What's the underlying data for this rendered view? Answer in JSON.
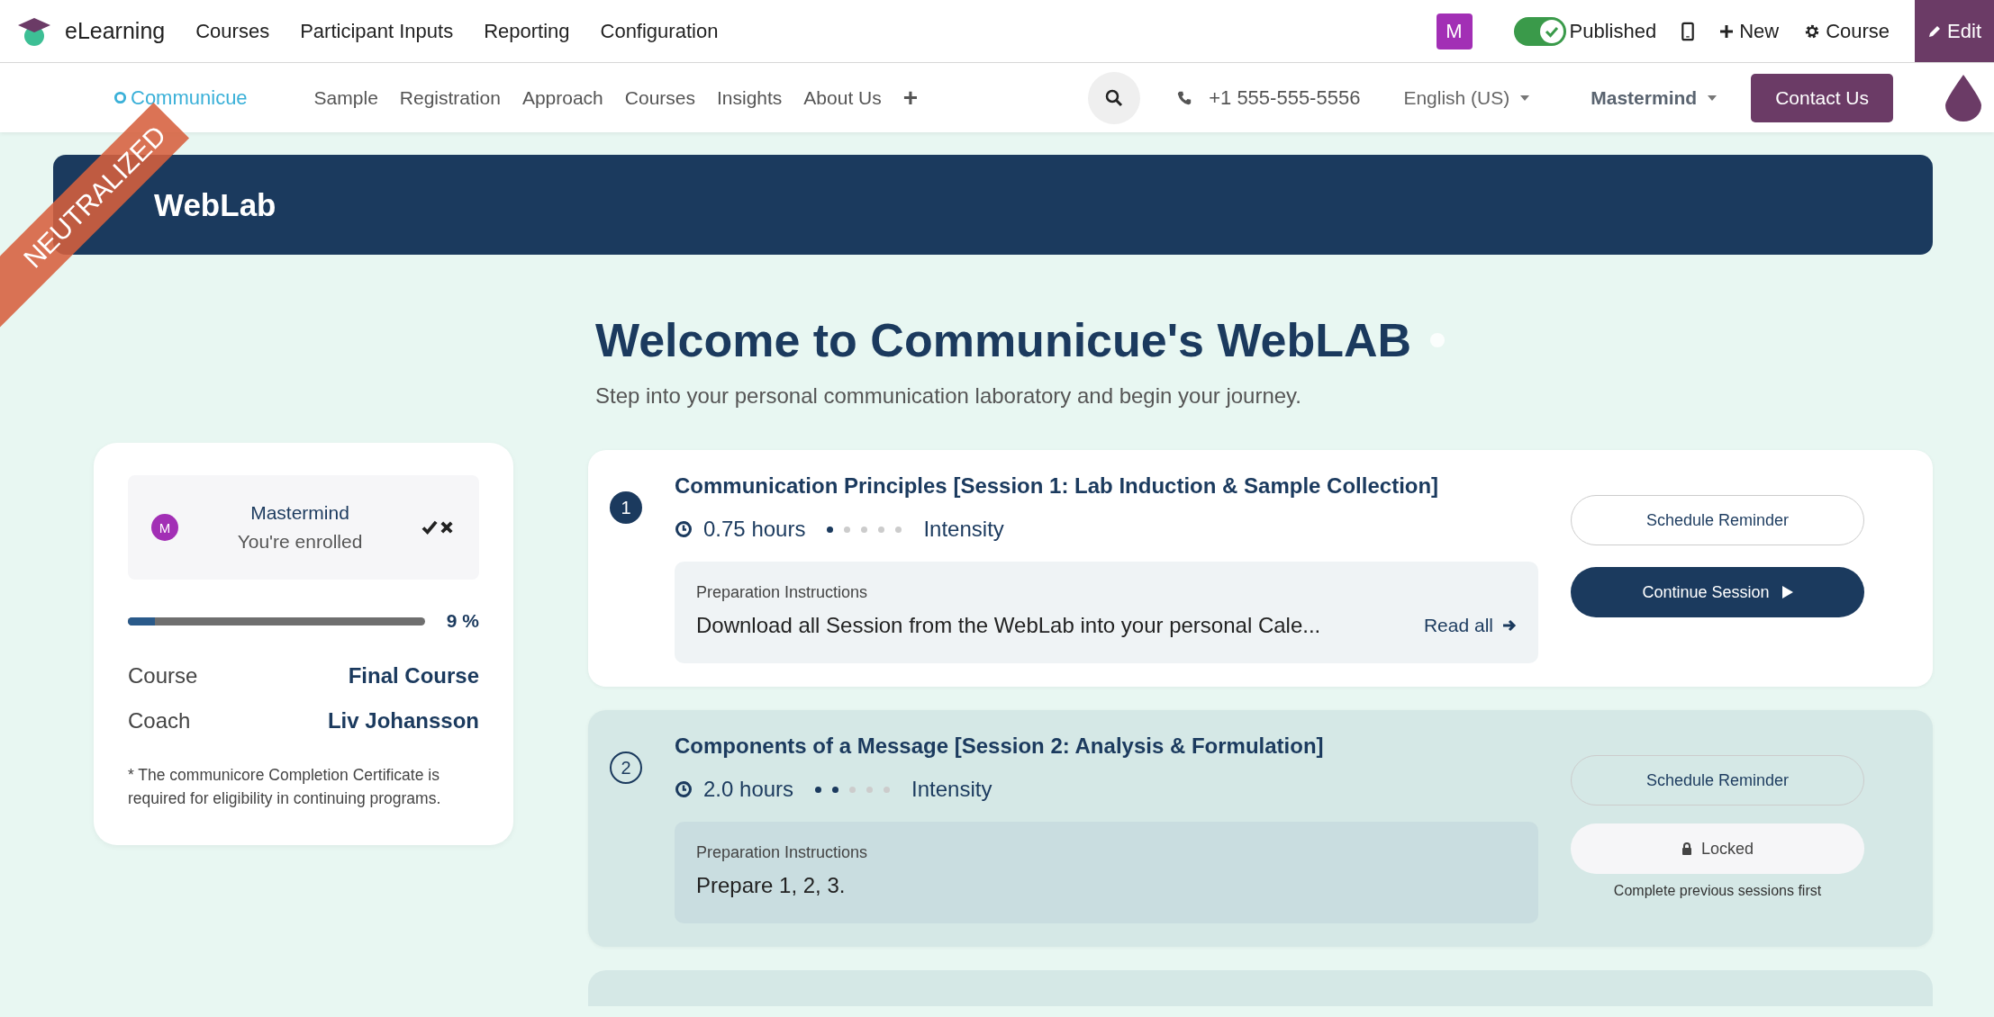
{
  "topbar": {
    "app_name": "eLearning",
    "menu": [
      "Courses",
      "Participant Inputs",
      "Reporting",
      "Configuration"
    ],
    "user_initial": "M",
    "published": {
      "label": "Published",
      "on": true
    },
    "new_label": "New",
    "course_label": "Course",
    "edit_label": "Edit"
  },
  "ribbon": "NEUTRALIZED",
  "sitenav": {
    "logo": "Communicue",
    "links": [
      "Sample",
      "Registration",
      "Approach",
      "Courses",
      "Insights",
      "About Us"
    ],
    "add": "+",
    "phone": "+1 555-555-5556",
    "language": "English (US)",
    "user": "Mastermind",
    "contact": "Contact Us"
  },
  "banner": {
    "title": "WebLab"
  },
  "welcome": {
    "title": "Welcome to Communicue's WebLAB",
    "subtitle": "Step into your personal communication laboratory and begin your journey."
  },
  "enrollment": {
    "avatar": "M",
    "name": "Mastermind",
    "status": "You're enrolled",
    "progress": {
      "level": 0.09,
      "label": "9 %"
    },
    "fields": [
      {
        "label": "Course",
        "value": "Final Course"
      },
      {
        "label": "Coach",
        "value": "Liv Johansson"
      }
    ],
    "note": "* The communicore Completion Certificate is required for eligibility in continuing programs."
  },
  "sessions": [
    {
      "number": "1",
      "title": "Communication Principles [Session 1: Lab Induction & Sample Collection]",
      "hours": "0.75 hours",
      "stars": 1,
      "intensity": "Intensity",
      "prep_label": "Preparation Instructions",
      "prep_text": "Download all Session from the WebLab into your personal Cale...",
      "read_all": "Read all",
      "locked": false,
      "reminder": "Schedule Reminder",
      "action": "Continue Session"
    },
    {
      "number": "2",
      "title": "Components of a Message [Session 2: Analysis & Formulation]",
      "hours": "2.0 hours",
      "stars": 2,
      "intensity": "Intensity",
      "prep_label": "Preparation Instructions",
      "prep_text": "Prepare 1, 2, 3.",
      "locked": true,
      "reminder": "Schedule Reminder",
      "action": "Locked",
      "hint": "Complete previous sessions first"
    }
  ]
}
